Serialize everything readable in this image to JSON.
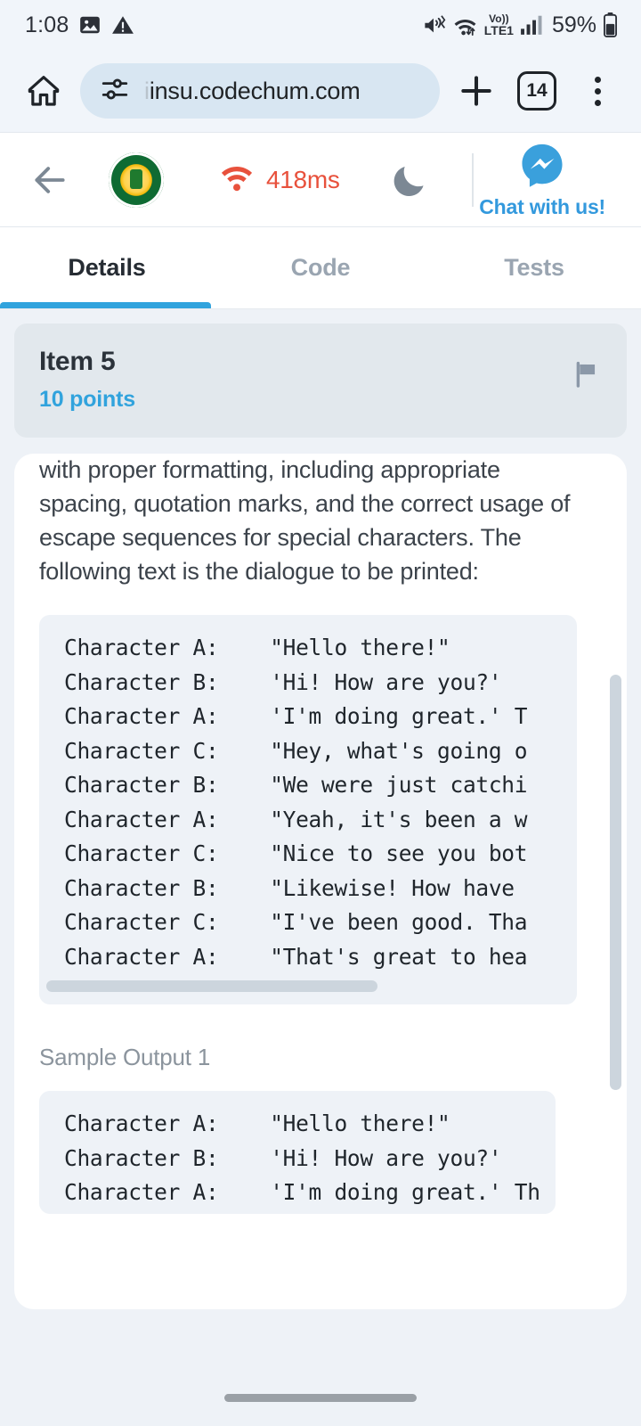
{
  "status_bar": {
    "time": "1:08",
    "battery_percent": "59%",
    "network_label": "LTE1",
    "volte_label": "Vo))",
    "icons": [
      "screenshot-icon",
      "warning-icon",
      "mute-icon",
      "wifi-icon",
      "volte-icon",
      "signal-icon",
      "battery-icon"
    ]
  },
  "browser": {
    "url": "insu.codechum.com",
    "url_prefix": "i",
    "tab_count": "14",
    "icons": [
      "home-icon",
      "site-settings-icon",
      "new-tab-icon",
      "tab-switcher-icon",
      "overflow-menu-icon"
    ]
  },
  "site_header": {
    "ping": "418ms",
    "chat_label": "Chat with us!",
    "logo_alt": "state-university-seal"
  },
  "tabs": {
    "items": [
      {
        "label": "Details",
        "active": true
      },
      {
        "label": "Code",
        "active": false
      },
      {
        "label": "Tests",
        "active": false
      }
    ]
  },
  "item": {
    "title": "Item 5",
    "points": "10 points"
  },
  "description": {
    "line_clipped": "with proper formatting, including appropriate",
    "body": "spacing, quotation marks, and the correct usage of escape sequences for special characters. The following text is the dialogue to be printed:"
  },
  "dialogue_block": {
    "lines": [
      "Character A:    \"Hello there!\"",
      "Character B:    'Hi! How are you?'",
      "Character A:    'I'm doing great.' T",
      "Character C:    \"Hey, what's going o",
      "Character B:    \"We were just catchi",
      "Character A:    \"Yeah, it's been a w",
      "Character C:    \"Nice to see you bot",
      "Character B:    \"Likewise! How have ",
      "Character C:    \"I've been good. Tha",
      "Character A:    \"That's great to hea"
    ]
  },
  "sample_output": {
    "label": "Sample Output 1",
    "lines": [
      "Character A:    \"Hello there!\"",
      "Character B:    'Hi! How are you?'",
      "Character A:    'I'm doing great.' Th"
    ]
  },
  "colors": {
    "accent_blue": "#31a3dd",
    "ping_red": "#e8513c",
    "page_bg": "#eef2f7",
    "card_bg": "#ffffff",
    "code_bg": "#eef2f7",
    "item_card_bg": "#e2e8ed"
  }
}
